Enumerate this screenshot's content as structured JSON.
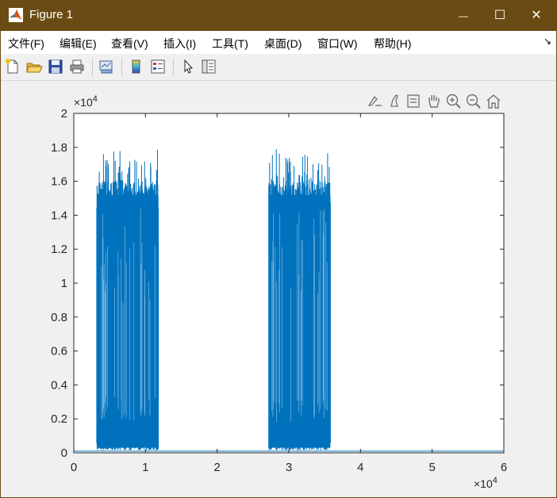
{
  "window": {
    "title": "Figure 1",
    "minimize_glyph": "—",
    "maximize_glyph": "☐",
    "close_glyph": "✕"
  },
  "menu": [
    {
      "label": "文件(F)"
    },
    {
      "label": "编辑(E)"
    },
    {
      "label": "查看(V)"
    },
    {
      "label": "插入(I)"
    },
    {
      "label": "工具(T)"
    },
    {
      "label": "桌面(D)"
    },
    {
      "label": "窗口(W)"
    },
    {
      "label": "帮助(H)"
    }
  ],
  "menu_dock_glyph": "↘",
  "toolbar_icons": [
    "new-figure-icon",
    "open-file-icon",
    "save-icon",
    "print-icon",
    "link-plot-icon",
    "insert-colorbar-icon",
    "insert-legend-icon",
    "edit-plot-arrow-icon",
    "property-inspector-icon"
  ],
  "axes_toolbar_icons": [
    "export-brush-icon",
    "brush-icon",
    "data-tips-icon",
    "pan-hand-icon",
    "zoom-in-icon",
    "zoom-out-icon",
    "restore-view-home-icon"
  ],
  "chart_data": {
    "type": "line",
    "title": "",
    "xlabel": "",
    "ylabel": "",
    "xlim": [
      0,
      60000
    ],
    "ylim": [
      0,
      20000
    ],
    "x_exponent_label": "×10",
    "x_exponent": "4",
    "y_exponent_label": "×10",
    "y_exponent": "4",
    "x_ticks": [
      0,
      10000,
      20000,
      30000,
      40000,
      50000,
      60000
    ],
    "x_tick_labels": [
      "0",
      "1",
      "2",
      "3",
      "4",
      "5",
      "6"
    ],
    "y_ticks": [
      0,
      2000,
      4000,
      6000,
      8000,
      10000,
      12000,
      14000,
      16000,
      18000,
      20000
    ],
    "y_tick_labels": [
      "0",
      "0.2",
      "0.4",
      "0.6",
      "0.8",
      "1",
      "1.2",
      "1.4",
      "1.6",
      "1.8",
      "2"
    ],
    "grid": false,
    "series": [
      {
        "color": "#0072bd",
        "baseline": 100,
        "bursts": [
          {
            "x_start": 3200,
            "x_end": 11800,
            "min": 300,
            "typical_high": 16000,
            "max": 18200
          },
          {
            "x_start": 27200,
            "x_end": 35800,
            "min": 300,
            "typical_high": 16000,
            "max": 18200
          }
        ]
      }
    ]
  }
}
